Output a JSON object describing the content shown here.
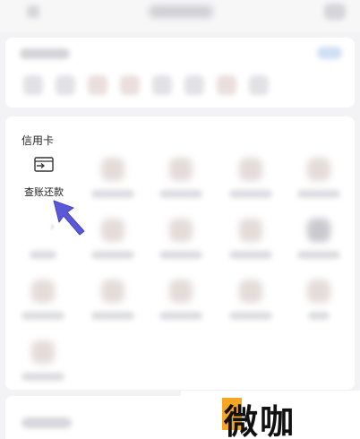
{
  "section": {
    "title": "信用卡"
  },
  "feature": {
    "label": "查账还款",
    "icon": "card-return-icon"
  },
  "cursor": {
    "icon": "pointer-arrow-icon",
    "color": "#5b58d8"
  },
  "watermark": {
    "text": "微咖",
    "accent_color": "#f5a623"
  }
}
